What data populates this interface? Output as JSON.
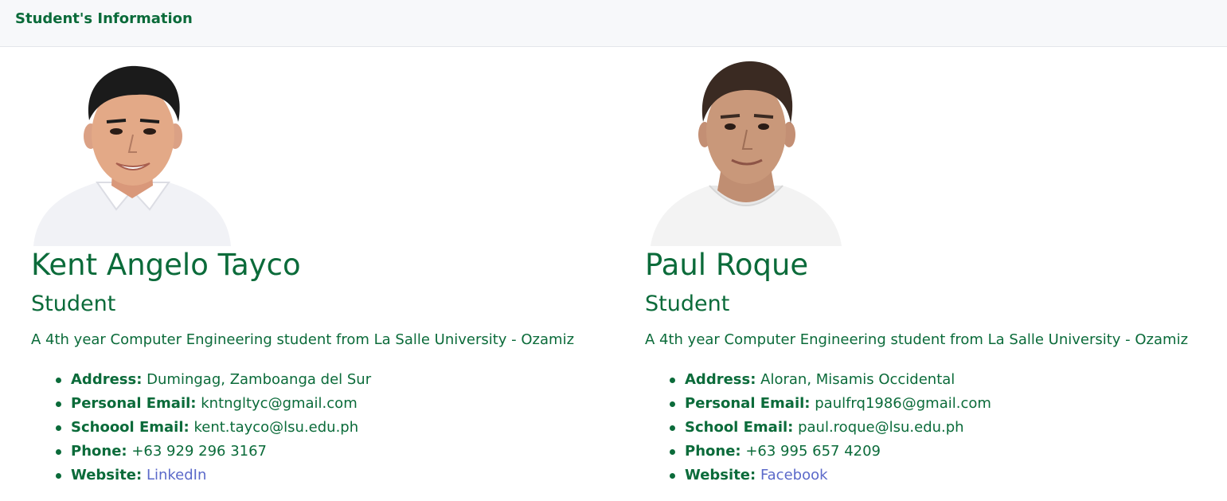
{
  "header": {
    "title": "Student's Information"
  },
  "students": [
    {
      "name": "Kent Angelo Tayco",
      "role": "Student",
      "description": "A 4th year Computer Engineering student from La Salle University - Ozamiz",
      "address_label": "Address:",
      "address": "Dumingag, Zamboanga del Sur",
      "personal_email_label": "Personal Email:",
      "personal_email": "kntngltyc@gmail.com",
      "school_email_label": "Schoool Email:",
      "school_email": "kent.tayco@lsu.edu.ph",
      "phone_label": "Phone:",
      "phone": "+63 929 296 3167",
      "website_label": "Website:",
      "website": "LinkedIn",
      "photo": {
        "shirt": "#f1f2f6",
        "skin": "#e3a987",
        "hair": "#1b1b1b"
      }
    },
    {
      "name": "Paul Roque",
      "role": "Student",
      "description": "A 4th year Computer Engineering student from La Salle University - Ozamiz",
      "address_label": "Address:",
      "address": "Aloran, Misamis Occidental",
      "personal_email_label": "Personal Email:",
      "personal_email": "paulfrq1986@gmail.com",
      "school_email_label": "School Email:",
      "school_email": "paul.roque@lsu.edu.ph",
      "phone_label": "Phone:",
      "phone": "+63 995 657 4209",
      "website_label": "Website:",
      "website": "Facebook",
      "photo": {
        "shirt": "#f3f3f3",
        "skin": "#c9987a",
        "hair": "#3a2a22"
      }
    }
  ],
  "colors": {
    "primary": "#0b6b3a",
    "link": "#5b69c9",
    "header_bg": "#f7f8fa"
  }
}
